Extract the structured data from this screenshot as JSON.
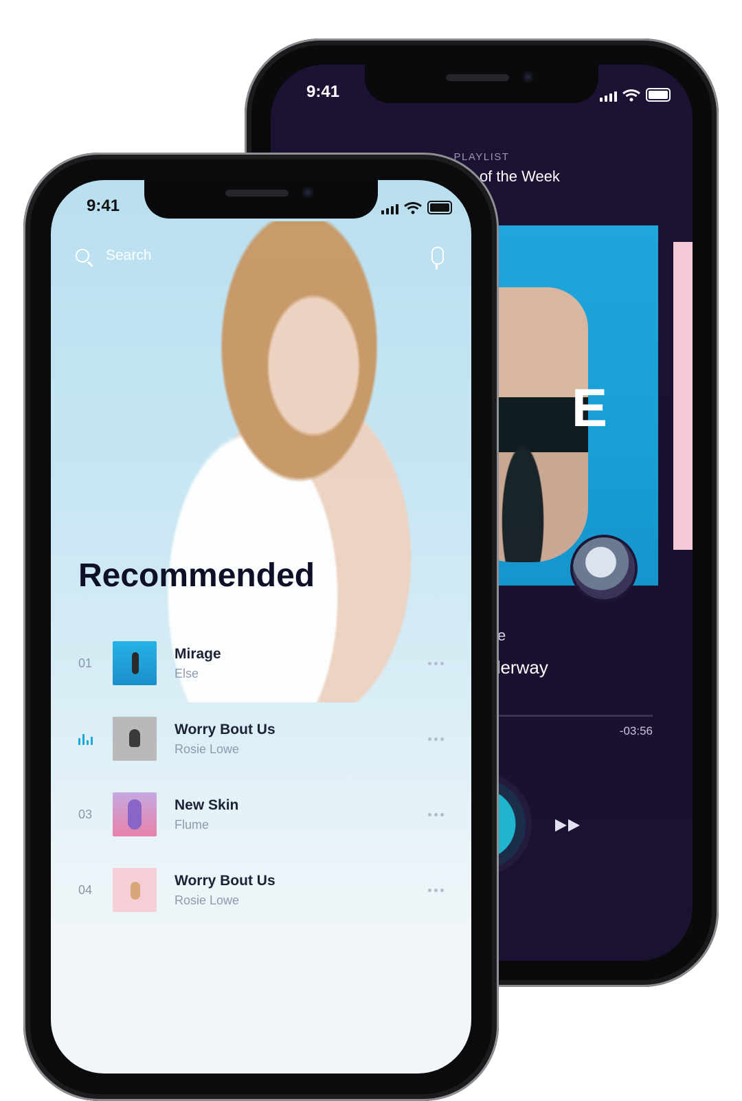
{
  "back_phone": {
    "status": {
      "time": "9:41"
    },
    "header": {
      "label": "PLAYLIST",
      "title": "Best Vibes of the Week"
    },
    "album": {
      "letter": "E"
    },
    "now_playing": {
      "title": "e",
      "artist": "derway"
    },
    "player": {
      "time_remaining": "-03:56"
    },
    "icons": {
      "collapse": "chevron-down-icon",
      "next": "fast-forward-icon"
    }
  },
  "front_phone": {
    "status": {
      "time": "9:41"
    },
    "search": {
      "placeholder": "Search"
    },
    "section_title": "Recommended",
    "tracks": [
      {
        "number": "01",
        "title": "Mirage",
        "artist": "Else",
        "playing": false
      },
      {
        "number": "",
        "title": "Worry Bout Us",
        "artist": "Rosie Lowe",
        "playing": true
      },
      {
        "number": "03",
        "title": "New Skin",
        "artist": "Flume",
        "playing": false
      },
      {
        "number": "04",
        "title": "Worry Bout Us",
        "artist": "Rosie Lowe",
        "playing": false
      }
    ],
    "colors": {
      "accent": "#1aa7d9",
      "title": "#0e1028"
    }
  }
}
